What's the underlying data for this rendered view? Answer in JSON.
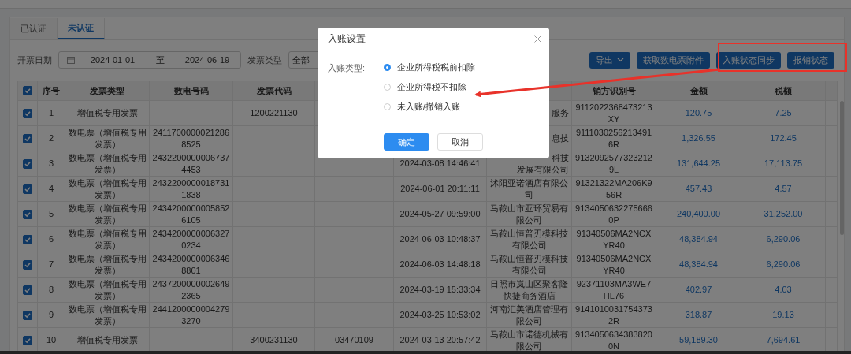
{
  "tabs": [
    {
      "label": "已认证",
      "selected": false
    },
    {
      "label": "未认证",
      "selected": true
    }
  ],
  "filters": {
    "date_label": "开票日期",
    "date_start": "2024-01-01",
    "date_separator": "至",
    "date_end": "2024-06-19",
    "type_label": "发票类型",
    "type_value": "全部"
  },
  "toolbar": [
    {
      "label": "导出",
      "dropdown": true
    },
    {
      "label": "获取数电票附件",
      "dropdown": false
    },
    {
      "label": "入账状态同步",
      "dropdown": false
    },
    {
      "label": "报销状态",
      "dropdown": false
    }
  ],
  "table": {
    "all_checked": true,
    "columns": {
      "no": "序号",
      "type": "发票类型",
      "number": "数电号码",
      "code": "发票代码",
      "seller_id": "销方识别号",
      "amount": "金额",
      "tax": "税额"
    },
    "rows": [
      {
        "checked": true,
        "no": "1",
        "type": "增值税专用发票",
        "code": "1200221130",
        "column_8": "服务",
        "seller_id": "9112022368473213XY",
        "amount": "120.75",
        "tax": "7.25"
      },
      {
        "checked": true,
        "no": "2",
        "type": "数电票（增值税专用发票）",
        "number": "24117000000212868525",
        "column_8": "息技",
        "seller_id": "91110302562134916R",
        "amount": "1,326.55",
        "tax": "172.45"
      },
      {
        "checked": true,
        "no": "3",
        "type": "数电票（增值税专用发票）",
        "number": "24322000000067374453",
        "column_7": "2024-03-08 14:46:41",
        "column_8": [
          "科技",
          "发展有限公司"
        ],
        "seller_id": "91320925773232129L",
        "amount": "131,644.25",
        "tax": "17,113.75"
      },
      {
        "checked": true,
        "no": "4",
        "type": "数电票（增值税专用发票）",
        "number": "24322000000187311838",
        "column_7": "2024-06-01 20:11:11",
        "column_8": "沭阳亚诺酒店有限公司",
        "seller_id": "91321322MA206K956R",
        "amount": "457.43",
        "tax": "4.57"
      },
      {
        "checked": true,
        "no": "5",
        "type": "数电票（增值税专用发票）",
        "number": "24342000000058526105",
        "column_7": "2024-05-27 09:59:00",
        "column_8": "马鞍山市亚环贸易有限公司",
        "seller_id": "91340506322756660P",
        "amount": "240,400.00",
        "tax": "31,252.00"
      },
      {
        "checked": true,
        "no": "6",
        "type": "数电票（增值税专用发票）",
        "number": "24342000000063270234",
        "column_7": "2024-06-03 10:48:37",
        "column_8": "马鞍山恒普刃模科技有限公司",
        "seller_id": "91340506MA2NCXYR40",
        "amount": "48,384.94",
        "tax": "6,290.06"
      },
      {
        "checked": true,
        "no": "7",
        "type": "数电票（增值税专用发票）",
        "number": "24342000000063468801",
        "column_7": "2024-06-03 14:48:18",
        "column_8": "马鞍山恒普刃模科技有限公司",
        "seller_id": "91340506MA2NCXYR40",
        "amount": "48,384.94",
        "tax": "6,290.06"
      },
      {
        "checked": true,
        "no": "8",
        "type": "数电票（增值税专用发票）",
        "number": "24372000000026492365",
        "column_7": "2024-03-19 15:33:34",
        "column_8": "日照市岚山区聚客隆快捷商务酒店",
        "seller_id": "92371103MA3WE7HL76",
        "amount": "402.97",
        "tax": "4.03"
      },
      {
        "checked": true,
        "no": "9",
        "type": "数电票（增值税专用发票）",
        "number": "24412000000042793270",
        "column_7": "2024-03-25 10:53:02",
        "column_8": "河南汇美酒店管理有限公司",
        "seller_id": "91410100317543732R",
        "amount": "318.87",
        "tax": "19.13"
      },
      {
        "checked": true,
        "no": "10",
        "type": "增值税专用发票",
        "code": "3400231130",
        "column_6": "03470109",
        "column_7": "2024-03-13 20:57:42",
        "column_8": "马鞍山市诺德机械有限公司",
        "seller_id": "91340506343838200N",
        "amount": "59,189.30",
        "tax": "7,694.61"
      }
    ]
  },
  "modal": {
    "title": "入账设置",
    "field_label": "入账类型:",
    "options": [
      {
        "label": "企业所得税税前扣除",
        "selected": true
      },
      {
        "label": "企业所得税不扣除",
        "selected": false
      },
      {
        "label": "未入账/撤销入账",
        "selected": false
      }
    ],
    "buttons": [
      {
        "label": "确定",
        "kind": "primary"
      },
      {
        "label": "取消",
        "kind": "default"
      }
    ]
  }
}
